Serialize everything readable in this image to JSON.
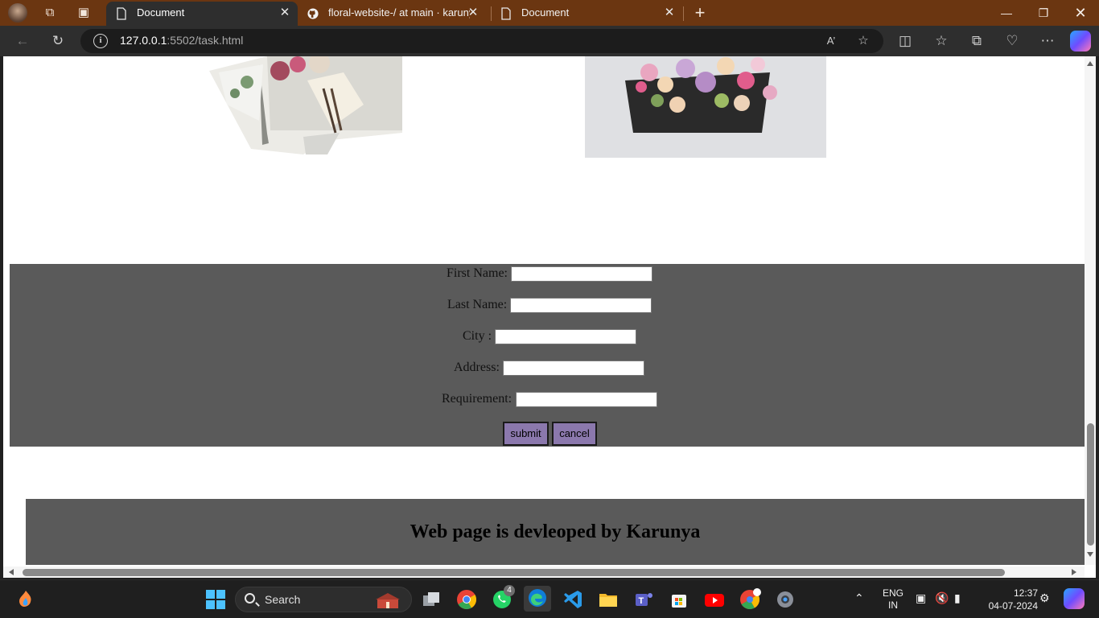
{
  "browser": {
    "tabs": [
      {
        "title": "Document",
        "active": true
      },
      {
        "title": "floral-website-/ at main · karunya",
        "active": false
      },
      {
        "title": "Document",
        "active": false
      }
    ],
    "url_host": "127.0.0.1",
    "url_rest": ":5502/task.html"
  },
  "form": {
    "first_name_label": "First Name:",
    "last_name_label": "Last Name:",
    "city_label": "City :",
    "address_label": "Address:",
    "requirement_label": "Requirement:",
    "submit_label": "submit",
    "cancel_label": "cancel"
  },
  "footer": {
    "text": "Web page is devleoped by Karunya"
  },
  "taskbar": {
    "search_placeholder": "Search",
    "whatsapp_badge": "4",
    "lang_line1": "ENG",
    "lang_line2": "IN",
    "time": "12:37",
    "date": "04-07-2024"
  },
  "colors": {
    "titlebar": "#6b3611",
    "form_bg": "#5a5a5a",
    "button_bg": "#8b78ad"
  }
}
